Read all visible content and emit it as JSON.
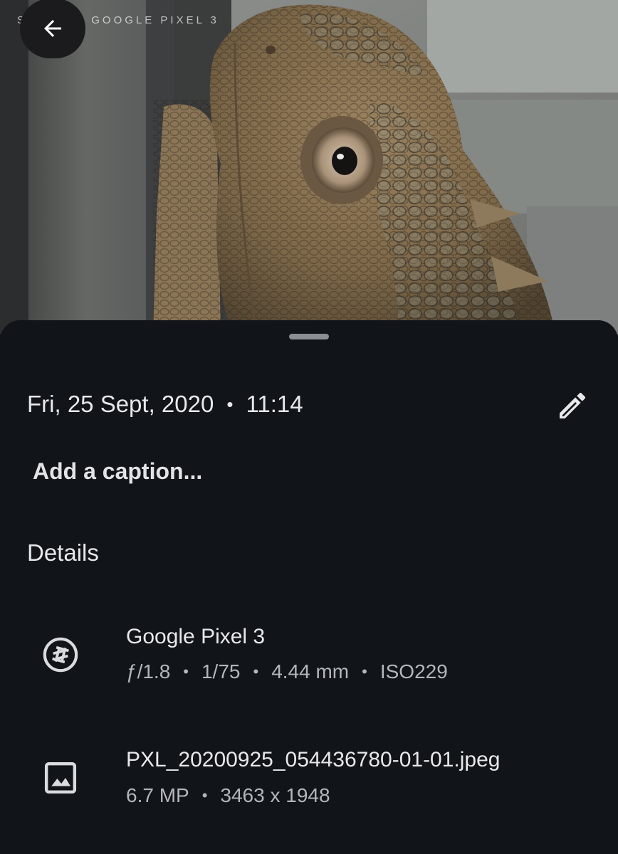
{
  "photo": {
    "watermark": "SHOT ON GOOGLE PIXEL 3"
  },
  "back_button": {
    "icon": "arrow-back-icon"
  },
  "sheet": {
    "date": "Fri, 25 Sept, 2020",
    "separator": "•",
    "time": "11:14",
    "edit_icon": "pencil-icon",
    "caption_placeholder": "Add a caption...",
    "details_title": "Details",
    "camera": {
      "icon": "camera-aperture-icon",
      "title": "Google Pixel 3",
      "aperture": "ƒ/1.8",
      "shutter": "1/75",
      "focal_length": "4.44 mm",
      "iso": "ISO229"
    },
    "file": {
      "icon": "image-icon",
      "title": "PXL_20200925_054436780-01-01.jpeg",
      "megapixels": "6.7 MP",
      "resolution": "3463 x 1948"
    }
  },
  "colors": {
    "sheet_background": "#111418",
    "primary_text": "#e6e8ea",
    "secondary_text": "#b3b6ba"
  }
}
